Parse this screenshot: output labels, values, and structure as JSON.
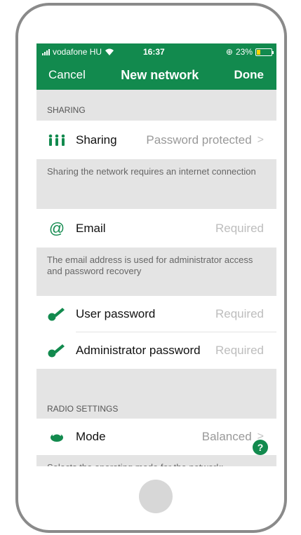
{
  "status_bar": {
    "carrier": "vodafone HU",
    "time": "16:37",
    "battery": "23%"
  },
  "nav": {
    "cancel": "Cancel",
    "title": "New network",
    "done": "Done"
  },
  "sections": {
    "sharing": {
      "header": "SHARING",
      "label": "Sharing",
      "value": "Password protected",
      "footer": "Sharing the network requires an internet connection"
    },
    "email": {
      "label": "Email",
      "placeholder": "Required",
      "footer": "The email address is used for administrator access and password recovery"
    },
    "passwords": {
      "user_label": "User password",
      "user_placeholder": "Required",
      "admin_label": "Administrator password",
      "admin_placeholder": "Required"
    },
    "radio": {
      "header": "RADIO SETTINGS",
      "label": "Mode",
      "value": "Balanced",
      "footer": "Selects the operating mode for the network:"
    }
  },
  "help_label": "?",
  "colors": {
    "brand_green": "#128a4e",
    "background_gray": "#e4e4e4"
  },
  "icons": [
    "signal-icon",
    "wifi-icon",
    "battery-icon",
    "people-icon",
    "at-icon",
    "key-icon",
    "router-icon",
    "chevron-right-icon",
    "help-icon"
  ]
}
